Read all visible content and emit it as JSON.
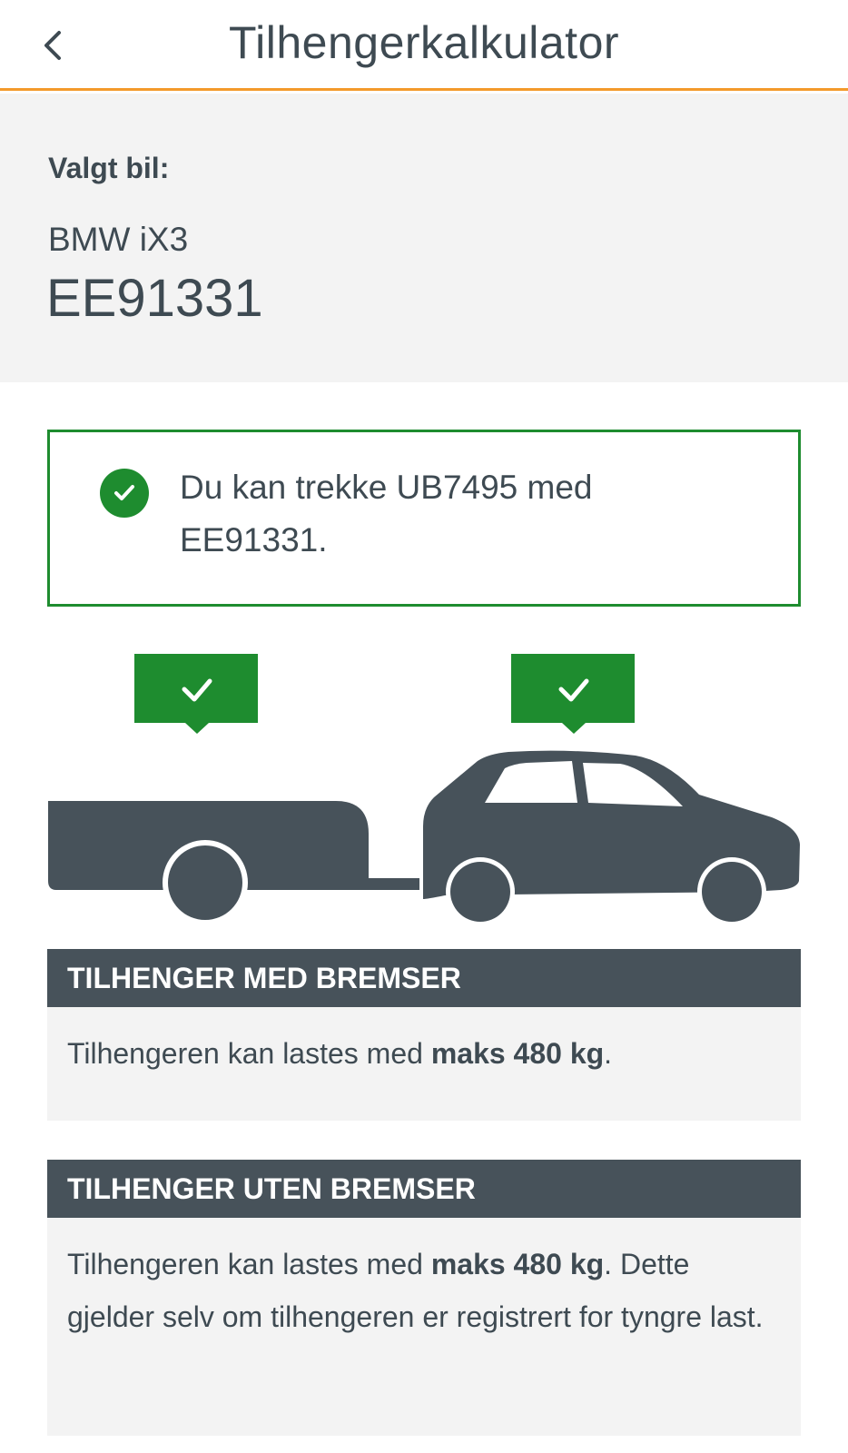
{
  "header": {
    "title": "Tilhengerkalkulator",
    "back_icon": "chevron-left-icon"
  },
  "car": {
    "label": "Valgt bil:",
    "model": "BMW iX3",
    "plate": "EE91331"
  },
  "result": {
    "icon": "check-circle-icon",
    "text": "Du kan trekke UB7495 med EE91331.",
    "status_color": "#1e8c2f"
  },
  "illustration": {
    "trailer_status_icon": "check-icon",
    "car_status_icon": "check-icon",
    "vehicle_color": "#47525a"
  },
  "sections": [
    {
      "title": "TILHENGER MED BREMSER",
      "text_before": "Tilhengeren kan lastes med ",
      "text_bold": "maks 480 kg",
      "text_after": "."
    },
    {
      "title": "TILHENGER UTEN BREMSER",
      "text_before": "Tilhengeren kan lastes med ",
      "text_bold": "maks 480 kg",
      "text_after": ". Dette gjelder selv om tilhengeren er registrert for tyngre last."
    }
  ]
}
